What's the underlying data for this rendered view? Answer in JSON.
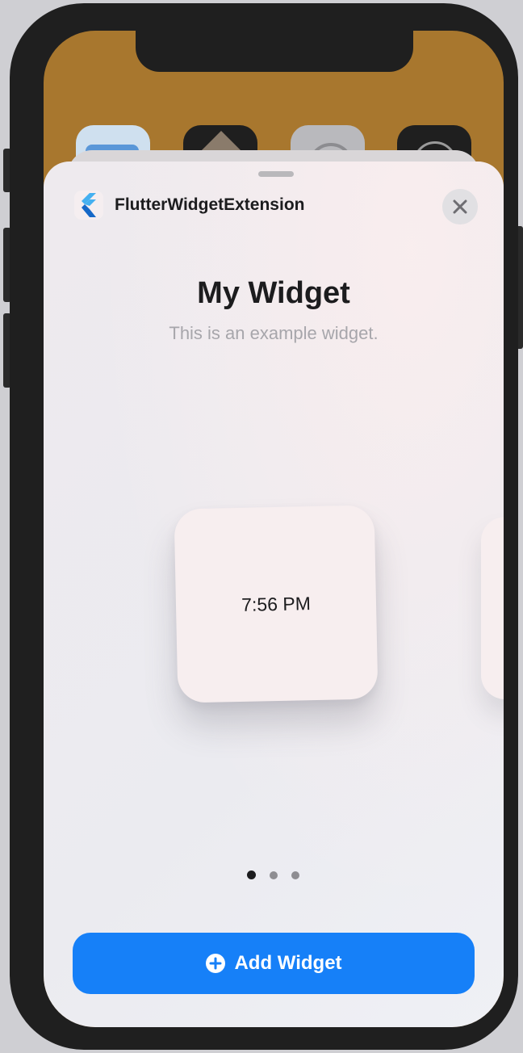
{
  "sheet": {
    "extension_name": "FlutterWidgetExtension",
    "close_icon": "close-icon",
    "app_icon": "flutter-logo-icon"
  },
  "widget_gallery": {
    "title": "My Widget",
    "description": "This is an example widget.",
    "widget_time": "7:56 PM",
    "page_count": 3,
    "current_page": 1
  },
  "actions": {
    "add_widget_label": "Add Widget",
    "add_icon": "plus-circle-icon"
  },
  "colors": {
    "accent": "#1680f8",
    "home_wallpaper": "#a8772e"
  }
}
